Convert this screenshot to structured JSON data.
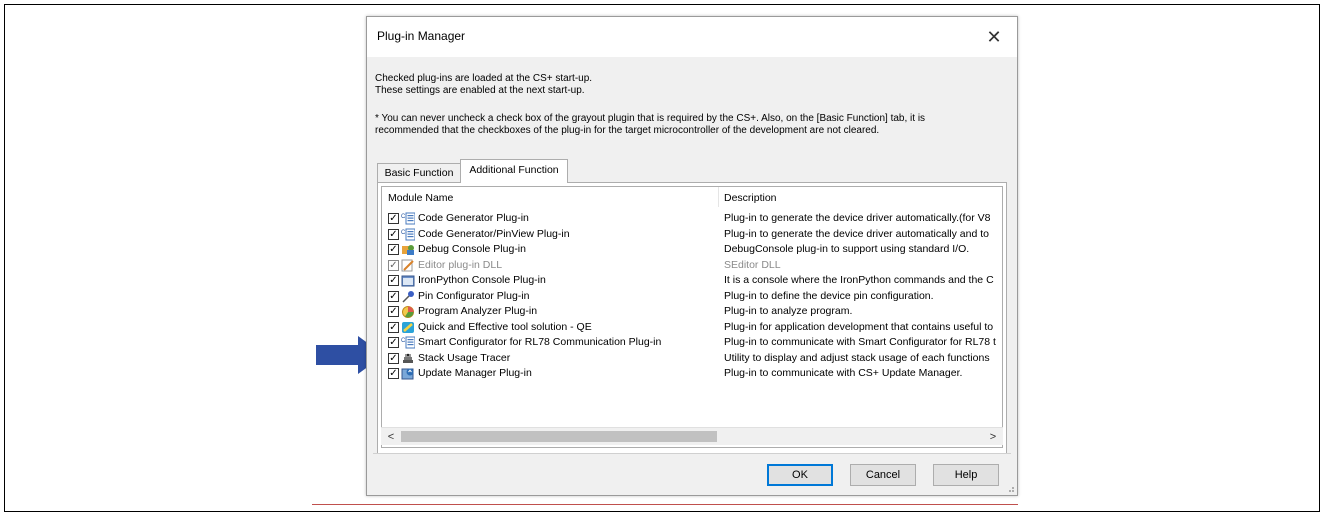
{
  "dialog": {
    "title": "Plug-in Manager",
    "close_glyph": "✕"
  },
  "info": {
    "line1": "Checked plug-ins are loaded at the CS+ start-up.",
    "line2": "These settings are enabled at the next start-up.",
    "note1": "* You can never uncheck a check box of the grayout plugin that is required by the CS+. Also, on the [Basic Function] tab, it is",
    "note2": "recommended that the checkboxes of the plug-in for the target microcontroller of the development are not cleared."
  },
  "tabs": [
    {
      "label": "Basic Function",
      "active": false
    },
    {
      "label": "Additional Function",
      "active": true
    }
  ],
  "list": {
    "columns": [
      "Module Name",
      "Description"
    ],
    "rows": [
      {
        "name": "Code Generator Plug-in",
        "description": "Plug-in to generate the device driver automatically.(for V8",
        "checked": true,
        "gray": false,
        "icon": "code-generator-icon"
      },
      {
        "name": "Code Generator/PinView Plug-in",
        "description": "Plug-in to generate the device driver automatically and to",
        "checked": true,
        "gray": false,
        "icon": "code-generator-icon"
      },
      {
        "name": "Debug Console Plug-in",
        "description": "DebugConsole plug-in to support using standard I/O.",
        "checked": true,
        "gray": false,
        "icon": "debug-console-icon"
      },
      {
        "name": "Editor plug-in DLL",
        "description": "SEditor DLL",
        "checked": true,
        "gray": true,
        "icon": "editor-icon"
      },
      {
        "name": "IronPython Console Plug-in",
        "description": "It is a console where the IronPython commands and the C",
        "checked": true,
        "gray": false,
        "icon": "console-icon"
      },
      {
        "name": "Pin Configurator Plug-in",
        "description": "Plug-in to define the device pin configuration.",
        "checked": true,
        "gray": false,
        "icon": "pin-configurator-icon"
      },
      {
        "name": "Program Analyzer Plug-in",
        "description": "Plug-in to analyze program.",
        "checked": true,
        "gray": false,
        "icon": "program-analyzer-icon"
      },
      {
        "name": "Quick and Effective tool solution - QE",
        "description": "Plug-in for application development that contains useful to",
        "checked": true,
        "gray": false,
        "icon": "qe-icon"
      },
      {
        "name": "Smart Configurator for RL78 Communication Plug-in",
        "description": "Plug-in to communicate with Smart Configurator for RL78 t",
        "checked": true,
        "gray": false,
        "icon": "code-generator-icon"
      },
      {
        "name": "Stack Usage Tracer",
        "description": "Utility to display and adjust stack usage of each functions",
        "checked": true,
        "gray": false,
        "icon": "stack-tracer-icon"
      },
      {
        "name": "Update Manager Plug-in",
        "description": "Plug-in to communicate with CS+ Update Manager.",
        "checked": true,
        "gray": false,
        "icon": "update-manager-icon"
      }
    ]
  },
  "scrollbar": {
    "left_glyph": "<",
    "right_glyph": ">"
  },
  "buttons": {
    "ok": "OK",
    "cancel": "Cancel",
    "help": "Help"
  },
  "colors": {
    "arrow": "#2e4fa3",
    "accent": "#0078d7",
    "underline": "#c0504d"
  }
}
